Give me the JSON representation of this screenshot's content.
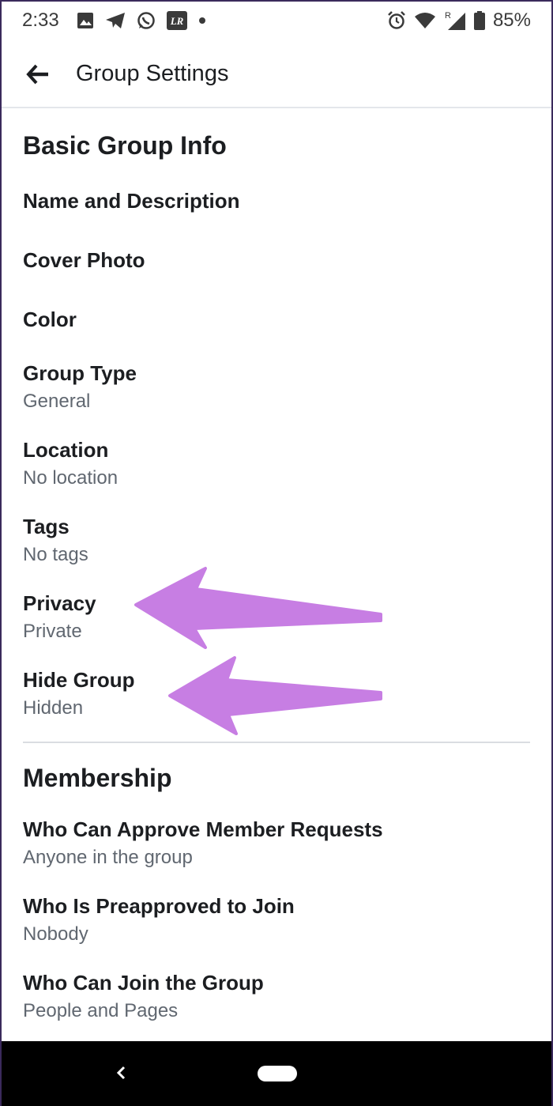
{
  "status_bar": {
    "time": "2:33",
    "left_icons": [
      "image-icon",
      "telegram-icon",
      "whatsapp-icon",
      "lr-icon",
      "dot-icon"
    ],
    "lr_text": "LR",
    "right_icons": [
      "alarm-icon",
      "wifi-icon",
      "signal-icon",
      "battery-icon"
    ],
    "signal_roaming": "R",
    "battery": "85%"
  },
  "app_bar": {
    "title": "Group Settings",
    "back_icon": "arrow-left-icon"
  },
  "sections": {
    "basic": {
      "title": "Basic Group Info",
      "items": [
        {
          "label": "Name and Description"
        },
        {
          "label": "Cover Photo"
        },
        {
          "label": "Color"
        },
        {
          "label": "Group Type",
          "value": "General"
        },
        {
          "label": "Location",
          "value": "No location"
        },
        {
          "label": "Tags",
          "value": "No tags"
        },
        {
          "label": "Privacy",
          "value": "Private"
        },
        {
          "label": "Hide Group",
          "value": "Hidden"
        }
      ]
    },
    "membership": {
      "title": "Membership",
      "items": [
        {
          "label": "Who Can Approve Member Requests",
          "value": "Anyone in the group"
        },
        {
          "label": "Who Is Preapproved to Join",
          "value": "Nobody"
        },
        {
          "label": "Who Can Join the Group",
          "value": "People and Pages"
        }
      ]
    }
  },
  "annotations": {
    "arrow_color": "#c77ee3",
    "arrows": [
      "pointer-arrow-privacy",
      "pointer-arrow-hide-group"
    ]
  },
  "nav_bar": {
    "back_icon": "chevron-left-icon",
    "home_icon": "home-pill-icon"
  }
}
